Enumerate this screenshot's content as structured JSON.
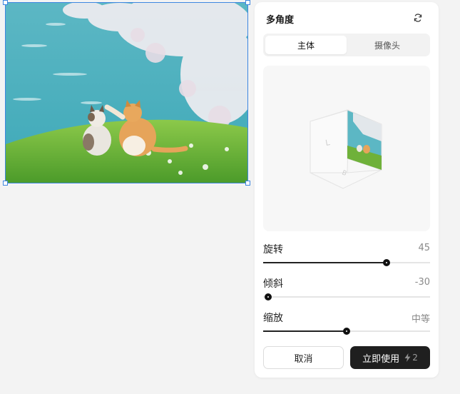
{
  "panel": {
    "title": "多角度",
    "tabs": [
      {
        "label": "主体",
        "active": true
      },
      {
        "label": "摄像头",
        "active": false
      }
    ]
  },
  "controls": {
    "rotate": {
      "label": "旋转",
      "value": "45",
      "level": 0.74
    },
    "tilt": {
      "label": "倾斜",
      "value": "-30",
      "level": 0.03
    },
    "zoom": {
      "label": "缩放",
      "value": "中等",
      "level": 0.5
    }
  },
  "buttons": {
    "cancel": "取消",
    "apply": "立即使用",
    "credits": "2"
  },
  "colors": {
    "selection": "#3d86e0",
    "primary_button": "#1f1f1f"
  },
  "icons": [
    "refresh-icon",
    "lightning-icon"
  ]
}
